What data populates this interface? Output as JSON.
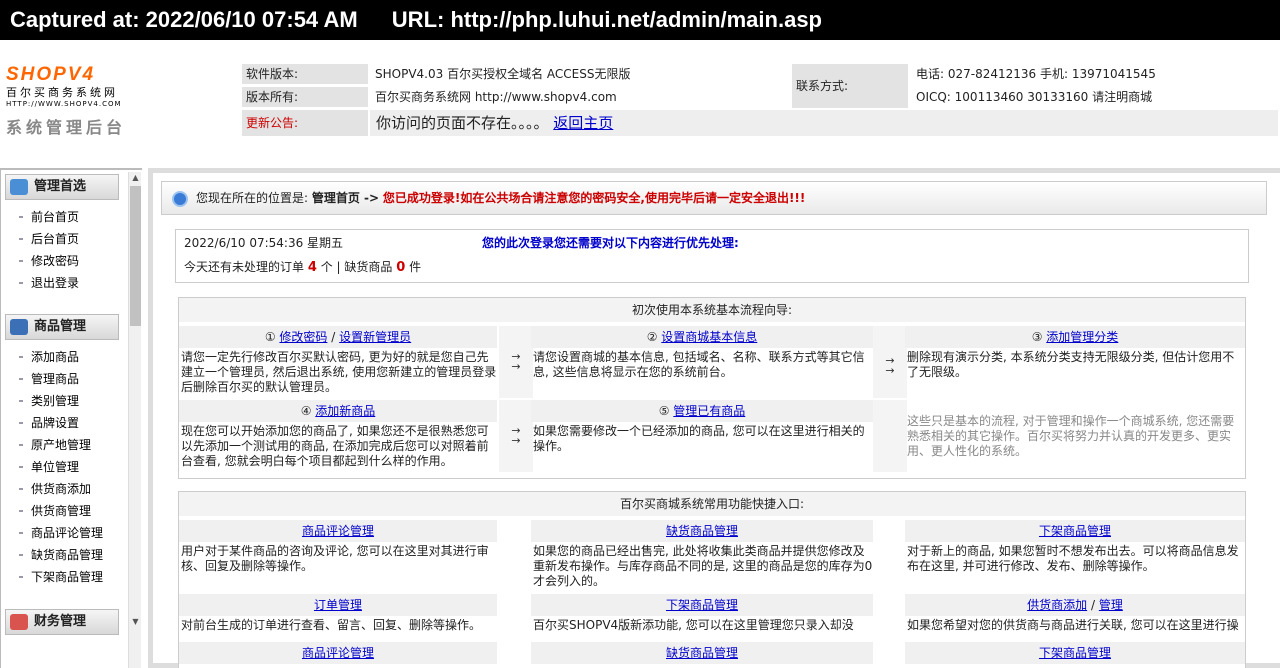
{
  "capture": {
    "captured_at": "Captured at: 2022/06/10 07:54 AM",
    "url": "URL: http://php.luhui.net/admin/main.asp"
  },
  "logo": {
    "brand": "SHOPV4",
    "cn": "百尔买商务系统网",
    "url": "HTTP://WWW.SHOPV4.COM",
    "subtitle": "系统管理后台"
  },
  "header": {
    "version_label": "软件版本:",
    "version_value": "SHOPV4.03 百尔买授权全域名 ACCESS无限版",
    "owner_label": "版本所有:",
    "owner_value": "百尔买商务系统网 http://www.shopv4.com",
    "notice_label": "更新公告:",
    "notice_text": "你访问的页面不存在。。。。",
    "notice_link": "返回主页",
    "contact_label": "联系方式:",
    "phone": "电话: 027-82412136 手机: 13971041545",
    "qq": "OICQ: 100113460 30133160 请注明商城"
  },
  "sidebar": {
    "sections": [
      {
        "title": "管理首选",
        "items": [
          "前台首页",
          "后台首页",
          "修改密码",
          "退出登录"
        ]
      },
      {
        "title": "商品管理",
        "items": [
          "添加商品",
          "管理商品",
          "类别管理",
          "品牌设置",
          "原产地管理",
          "单位管理",
          "供货商添加",
          "供货商管理",
          "商品评论管理",
          "缺货商品管理",
          "下架商品管理"
        ]
      },
      {
        "title": "财务管理",
        "items": []
      }
    ]
  },
  "location": {
    "prefix": "您现在所在的位置是:",
    "page": "管理首页 ->",
    "warning": "您已成功登录!如在公共场合请注意您的密码安全,使用完毕后请一定安全退出!!!"
  },
  "status": {
    "datetime": "2022/6/10 07:54:36 星期五",
    "priority": "您的此次登录您还需要对以下内容进行优先处理:",
    "orders_prefix": "今天还有未处理的订单",
    "orders_count": "4",
    "orders_unit": "个 | 缺货商品",
    "stockout_count": "0",
    "stockout_unit": "件"
  },
  "wizard": {
    "title": "初次使用本系统基本流程向导:",
    "arrow": "→",
    "steps": [
      {
        "num": "①",
        "link": "修改密码",
        "sep": "/",
        "link2": "设置新管理员",
        "desc": "请您一定先行修改百尔买默认密码, 更为好的就是您自己先建立一个管理员, 然后退出系统, 使用您新建立的管理员登录后删除百尔买的默认管理员。"
      },
      {
        "num": "②",
        "link": "设置商城基本信息",
        "desc": "请您设置商城的基本信息, 包括域名、名称、联系方式等其它信息, 这些信息将显示在您的系统前台。"
      },
      {
        "num": "③",
        "link": "添加管理分类",
        "desc": "删除现有演示分类, 本系统分类支持无限级分类, 但估计您用不了无限级。"
      },
      {
        "num": "④",
        "link": "添加新商品",
        "desc": "现在您可以开始添加您的商品了, 如果您还不是很熟悉您可以先添加一个测试用的商品, 在添加完成后您可以对照着前台查看, 您就会明白每个项目都起到什么样的作用。"
      },
      {
        "num": "⑤",
        "link": "管理已有商品",
        "desc": "如果您需要修改一个已经添加的商品, 您可以在这里进行相关的操作。"
      },
      {
        "desc": "这些只是基本的流程, 对于管理和操作一个商城系统, 您还需要熟悉相关的其它操作。百尔买将努力并认真的开发更多、更实用、更人性化的系统。"
      }
    ]
  },
  "quick": {
    "title": "百尔买商城系统常用功能快捷入口:",
    "items": [
      {
        "link": "商品评论管理",
        "desc": "用户对于某件商品的咨询及评论, 您可以在这里对其进行审核、回复及删除等操作。"
      },
      {
        "link": "缺货商品管理",
        "desc": "如果您的商品已经出售完, 此处将收集此类商品并提供您修改及重新发布操作。与库存商品不同的是, 这里的商品是您的库存为0才会列入的。"
      },
      {
        "link": "下架商品管理",
        "desc": "对于新上的商品, 如果您暂时不想发布出去。可以将商品信息发布在这里, 并可进行修改、发布、删除等操作。"
      },
      {
        "link": "订单管理",
        "desc": "对前台生成的订单进行查看、留言、回复、删除等操作。"
      },
      {
        "link": "下架商品管理",
        "desc": "百尔买SHOPV4版新添功能, 您可以在这里管理您只录入却没"
      },
      {
        "link": "供货商添加",
        "sep": "/",
        "link2": "管理",
        "desc": "如果您希望对您的供货商与商品进行关联, 您可以在这里进行操"
      },
      {
        "link": "商品评论管理"
      },
      {
        "link": "缺货商品管理"
      },
      {
        "link": "下架商品管理"
      }
    ]
  },
  "colors": {
    "warning": "#cc0000",
    "link": "#0000cc",
    "logo_orange": "#ff6600"
  }
}
